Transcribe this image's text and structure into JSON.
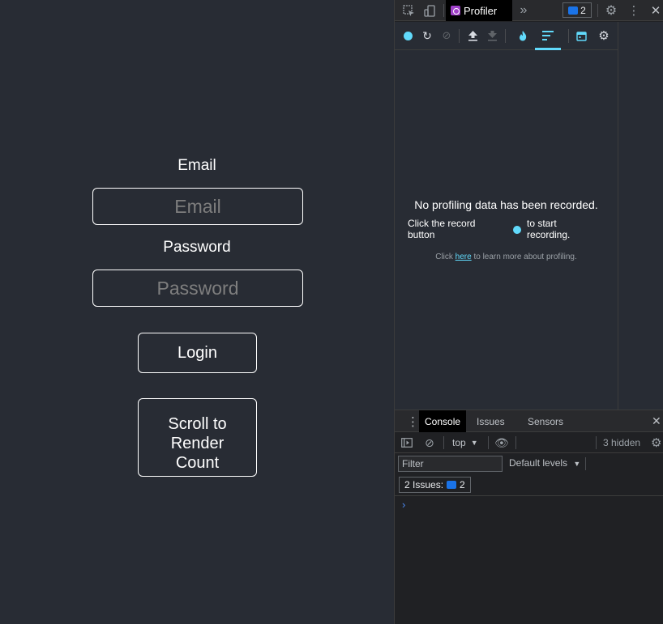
{
  "app": {
    "email_label": "Email",
    "email_placeholder": "Email",
    "email_value": "",
    "password_label": "Password",
    "password_placeholder": "Password",
    "password_value": "",
    "login_label": "Login",
    "scroll_label_lines": [
      "Scroll to",
      "Render",
      "Count"
    ]
  },
  "devtools": {
    "active_tab": "Profiler",
    "more_tabs_glyph": "»",
    "issues_count": "2",
    "profiler": {
      "no_data_title": "No profiling data has been recorded.",
      "hint_left": "Click the record button",
      "hint_right": "to start recording.",
      "learn_prefix": "Click ",
      "learn_link": "here",
      "learn_suffix": " to learn more about profiling."
    },
    "drawer": {
      "tabs": [
        "Console",
        "Issues",
        "Sensors"
      ],
      "active_tab": "Console",
      "context": "top",
      "hidden_count": "3 hidden",
      "filter_placeholder": "Filter",
      "levels_label": "Default levels",
      "issues_label": "2 Issues:",
      "issues_count": "2",
      "prompt_glyph": "›"
    },
    "colors": {
      "accent": "#61dafb",
      "issue_blue": "#1a73e8"
    }
  }
}
